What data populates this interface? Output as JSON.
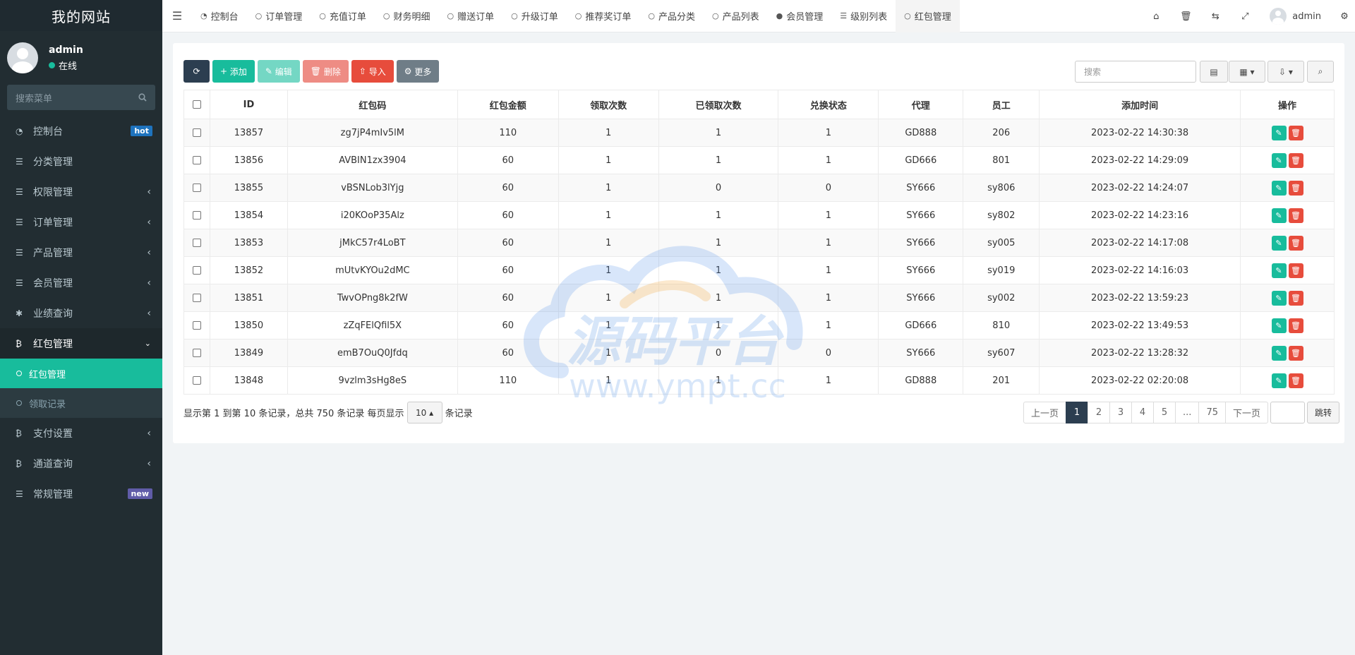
{
  "site_title": "我的网站",
  "user": {
    "name": "admin",
    "status": "在线"
  },
  "sidebar_search_placeholder": "搜索菜单",
  "sidebar": {
    "items": [
      {
        "label": "控制台",
        "icon": "dashboard-icon",
        "badge": "hot",
        "badge_color": "#1e73be"
      },
      {
        "label": "分类管理",
        "icon": "list-icon"
      },
      {
        "label": "权限管理",
        "icon": "list-icon"
      },
      {
        "label": "订单管理",
        "icon": "list-icon"
      },
      {
        "label": "产品管理",
        "icon": "list-icon"
      },
      {
        "label": "会员管理",
        "icon": "list-icon"
      },
      {
        "label": "业绩查询",
        "icon": "asterisk-icon"
      },
      {
        "label": "红包管理",
        "icon": "bitcoin-icon"
      }
    ],
    "sub_items": [
      {
        "label": "红包管理"
      },
      {
        "label": "领取记录"
      }
    ],
    "bottom_items": [
      {
        "label": "支付设置",
        "icon": "bitcoin-icon"
      },
      {
        "label": "通道查询",
        "icon": "bitcoin-icon"
      },
      {
        "label": "常规管理",
        "icon": "list-icon",
        "badge": "new",
        "badge_color": "#605ca8"
      }
    ]
  },
  "tabs": [
    {
      "label": "控制台",
      "icon": "dashboard-icon"
    },
    {
      "label": "订单管理",
      "icon": "circle-icon"
    },
    {
      "label": "充值订单",
      "icon": "circle-icon"
    },
    {
      "label": "财务明细",
      "icon": "circle-icon"
    },
    {
      "label": "赠送订单",
      "icon": "circle-icon"
    },
    {
      "label": "升级订单",
      "icon": "circle-icon"
    },
    {
      "label": "推荐奖订单",
      "icon": "circle-icon"
    },
    {
      "label": "产品分类",
      "icon": "circle-icon"
    },
    {
      "label": "产品列表",
      "icon": "circle-icon"
    },
    {
      "label": "会员管理",
      "icon": "user-icon"
    },
    {
      "label": "级别列表",
      "icon": "list-icon"
    },
    {
      "label": "红包管理",
      "icon": "circle-icon"
    }
  ],
  "top_user": "admin",
  "toolbar": {
    "add": "添加",
    "edit": "编辑",
    "delete": "删除",
    "import": "导入",
    "more": "更多"
  },
  "search_placeholder": "搜索",
  "table": {
    "headers": [
      "ID",
      "红包码",
      "红包金额",
      "领取次数",
      "已领取次数",
      "兑换状态",
      "代理",
      "员工",
      "添加时间",
      "操作"
    ],
    "rows": [
      [
        "13857",
        "zg7jP4mIv5lM",
        "110",
        "1",
        "1",
        "1",
        "GD888",
        "206",
        "2023-02-22 14:30:38"
      ],
      [
        "13856",
        "AVBIN1zx3904",
        "60",
        "1",
        "1",
        "1",
        "GD666",
        "801",
        "2023-02-22 14:29:09"
      ],
      [
        "13855",
        "vBSNLob3lYjg",
        "60",
        "1",
        "0",
        "0",
        "SY666",
        "sy806",
        "2023-02-22 14:24:07"
      ],
      [
        "13854",
        "i20KOoP35Alz",
        "60",
        "1",
        "1",
        "1",
        "SY666",
        "sy802",
        "2023-02-22 14:23:16"
      ],
      [
        "13853",
        "jMkC57r4LoBT",
        "60",
        "1",
        "1",
        "1",
        "SY666",
        "sy005",
        "2023-02-22 14:17:08"
      ],
      [
        "13852",
        "mUtvKYOu2dMC",
        "60",
        "1",
        "1",
        "1",
        "SY666",
        "sy019",
        "2023-02-22 14:16:03"
      ],
      [
        "13851",
        "TwvOPng8k2fW",
        "60",
        "1",
        "1",
        "1",
        "SY666",
        "sy002",
        "2023-02-22 13:59:23"
      ],
      [
        "13850",
        "zZqFElQfil5X",
        "60",
        "1",
        "1",
        "1",
        "GD666",
        "810",
        "2023-02-22 13:49:53"
      ],
      [
        "13849",
        "emB7OuQ0Jfdq",
        "60",
        "1",
        "0",
        "0",
        "SY666",
        "sy607",
        "2023-02-22 13:28:32"
      ],
      [
        "13848",
        "9vzlm3sHg8eS",
        "110",
        "1",
        "1",
        "1",
        "GD888",
        "201",
        "2023-02-22 02:20:08"
      ]
    ]
  },
  "footer": {
    "info": "显示第 1 到第 10 条记录，总共 750 条记录 每页显示",
    "per_page": "10",
    "suffix": "条记录"
  },
  "pagination": [
    "上一页",
    "1",
    "2",
    "3",
    "4",
    "5",
    "...",
    "75",
    "下一页"
  ],
  "jump_label": "跳转",
  "watermark": {
    "title": "源码平台",
    "url": "www.ympt.cc"
  }
}
